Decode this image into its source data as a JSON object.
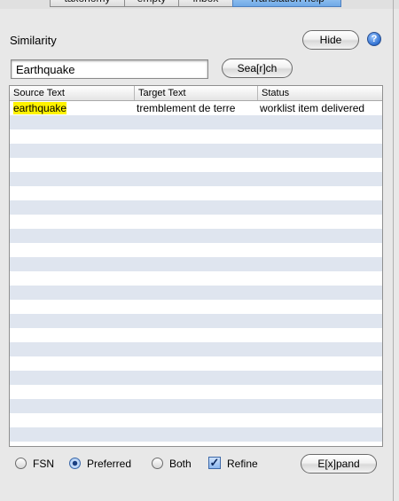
{
  "tabs": [
    {
      "label": "taxonomy",
      "selected": false
    },
    {
      "label": "empty",
      "selected": false
    },
    {
      "label": "inbox",
      "selected": false
    },
    {
      "label": "Translation help",
      "selected": true
    }
  ],
  "panel": {
    "title": "Similarity",
    "hide_label": "Hide",
    "help_glyph": "?"
  },
  "search": {
    "value": "Earthquake",
    "button_label": "Sea[r]ch"
  },
  "table": {
    "columns": [
      "Source Text",
      "Target Text",
      "Status"
    ],
    "rows": [
      {
        "source": "earthquake",
        "target": "tremblement de terre",
        "status": "worklist item delivered",
        "source_highlighted": true
      }
    ],
    "stripe_color": "#dfe5ef",
    "highlight_color": "#fff200"
  },
  "footer": {
    "options": [
      {
        "label": "FSN",
        "selected": false
      },
      {
        "label": "Preferred",
        "selected": true
      },
      {
        "label": "Both",
        "selected": false
      }
    ],
    "refine": {
      "label": "Refine",
      "checked": true
    },
    "expand_label": "E[x]pand"
  }
}
